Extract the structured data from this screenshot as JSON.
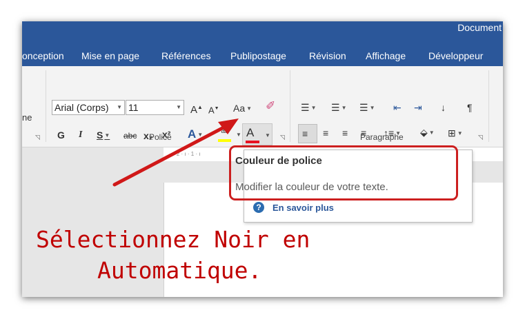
{
  "window": {
    "title": "Document"
  },
  "tabs": [
    "onception",
    "Mise en page",
    "Références",
    "Publipostage",
    "Révision",
    "Affichage",
    "Développeur"
  ],
  "ribbon": {
    "left_group_label": "ne",
    "font_group": {
      "label": "Police",
      "font_name": "Arial (Corps)",
      "font_size": "11",
      "grow_label": "A",
      "shrink_label": "A",
      "change_case_label": "Aa",
      "bold": "G",
      "italic": "I",
      "underline": "S",
      "strike": "abc",
      "subscript": "x₂",
      "superscript": "x²",
      "text_effects": "A",
      "highlight": "ab",
      "font_color": "A",
      "font_color_swatch": "#e81123",
      "highlight_swatch": "#ffff00"
    },
    "paragraph_group": {
      "label": "Paragraphe",
      "pilcrow": "¶"
    }
  },
  "ruler_text": "· 2 · ı · 1 · ı",
  "tooltip": {
    "title": "Couleur de police",
    "description": "Modifier la couleur de votre texte.",
    "help_link": "En savoir plus",
    "help_icon": "?"
  },
  "annotation": {
    "line1": "Sélectionnez Noir en",
    "line2": "Automatique.",
    "color": "#cc0000"
  },
  "colors": {
    "titlebar": "#2b579a",
    "annotation_red": "#cc1f1f"
  }
}
